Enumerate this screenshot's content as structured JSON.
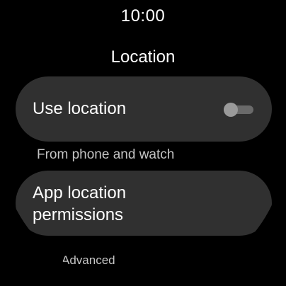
{
  "status_bar": {
    "time": "10:00"
  },
  "page": {
    "title": "Location"
  },
  "use_location": {
    "label": "Use location",
    "toggle_state": "off"
  },
  "section_note": "From phone and watch",
  "app_location_permissions": {
    "line1": "App location",
    "line2": "permissions"
  },
  "advanced_label": "Advanced",
  "colors": {
    "background": "#000000",
    "chip_background": "#303030",
    "text_primary": "#ffffff",
    "text_secondary": "#c4c4c4",
    "toggle_track_off": "#6a6a6a",
    "toggle_thumb_off": "#9a9a9a"
  }
}
